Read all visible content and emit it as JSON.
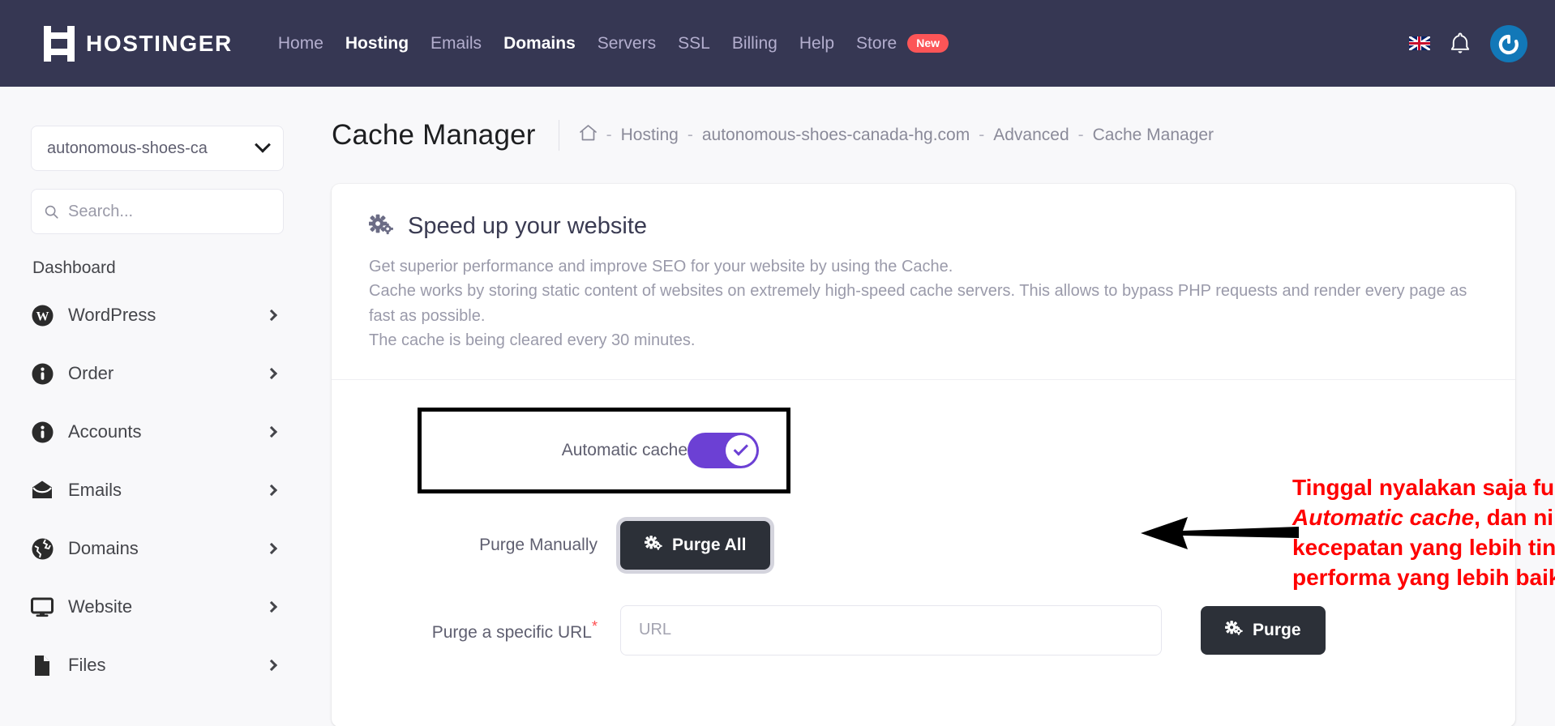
{
  "topbar": {
    "brand": "HOSTINGER",
    "nav": [
      {
        "label": "Home",
        "active": false
      },
      {
        "label": "Hosting",
        "active": true
      },
      {
        "label": "Emails",
        "active": false
      },
      {
        "label": "Domains",
        "active": true
      },
      {
        "label": "Servers",
        "active": false
      },
      {
        "label": "SSL",
        "active": false
      },
      {
        "label": "Billing",
        "active": false
      },
      {
        "label": "Help",
        "active": false
      },
      {
        "label": "Store",
        "active": false
      }
    ],
    "store_badge": "New",
    "icons": {
      "flag": "uk-flag-icon",
      "bell": "bell-icon",
      "avatar": "power-avatar-icon"
    },
    "colors": {
      "bar_bg": "#363753",
      "nav_muted": "#b3aece",
      "badge": "#fc5557",
      "avatar": "#1278b8"
    }
  },
  "sidebar": {
    "domain_selected": "autonomous-shoes-ca",
    "search_placeholder": "Search...",
    "search_value": "",
    "heading": "Dashboard",
    "items": [
      {
        "label": "WordPress",
        "icon": "wordpress-icon"
      },
      {
        "label": "Order",
        "icon": "info-circle-icon"
      },
      {
        "label": "Accounts",
        "icon": "info-circle-icon"
      },
      {
        "label": "Emails",
        "icon": "envelope-icon"
      },
      {
        "label": "Domains",
        "icon": "globe-icon"
      },
      {
        "label": "Website",
        "icon": "monitor-icon"
      },
      {
        "label": "Files",
        "icon": "file-icon"
      }
    ]
  },
  "header": {
    "title": "Cache Manager",
    "breadcrumb": [
      {
        "label": "⌂",
        "type": "home-icon"
      },
      {
        "label": "Hosting",
        "type": "link"
      },
      {
        "label": "autonomous-shoes-canada-hg.com",
        "type": "link"
      },
      {
        "label": "Advanced",
        "type": "link"
      },
      {
        "label": "Cache Manager",
        "type": "current"
      }
    ],
    "separator": "-"
  },
  "card": {
    "icon": "gears-icon",
    "title": "Speed up your website",
    "desc_lines": [
      "Get superior performance and improve SEO for your website by using the Cache.",
      "Cache works by storing static content of websites on extremely high-speed cache servers. This allows to bypass PHP requests and render every page as fast as possible.",
      "The cache is being cleared every 30 minutes."
    ],
    "automatic_cache_label": "Automatic cache",
    "automatic_cache_on": true,
    "purge_manually_label": "Purge Manually",
    "purge_all_label": "Purge All",
    "purge_url_label": "Purge a specific URL",
    "purge_url_required": "*",
    "url_placeholder": "URL",
    "url_value": "",
    "purge_label": "Purge",
    "toggle_color": "#6c40d4",
    "button_color": "#2c3038"
  },
  "annotation": {
    "line1": "Tinggal nyalakan saja fungsi",
    "emphasis": "Automatic cache",
    "line2_rest": ", dan nikmati",
    "line3": "kecepatan yang lebih tinggi dan",
    "line4": "performa yang lebih baik",
    "color": "#ff0000",
    "arrow": "left-arrow-annotation"
  }
}
